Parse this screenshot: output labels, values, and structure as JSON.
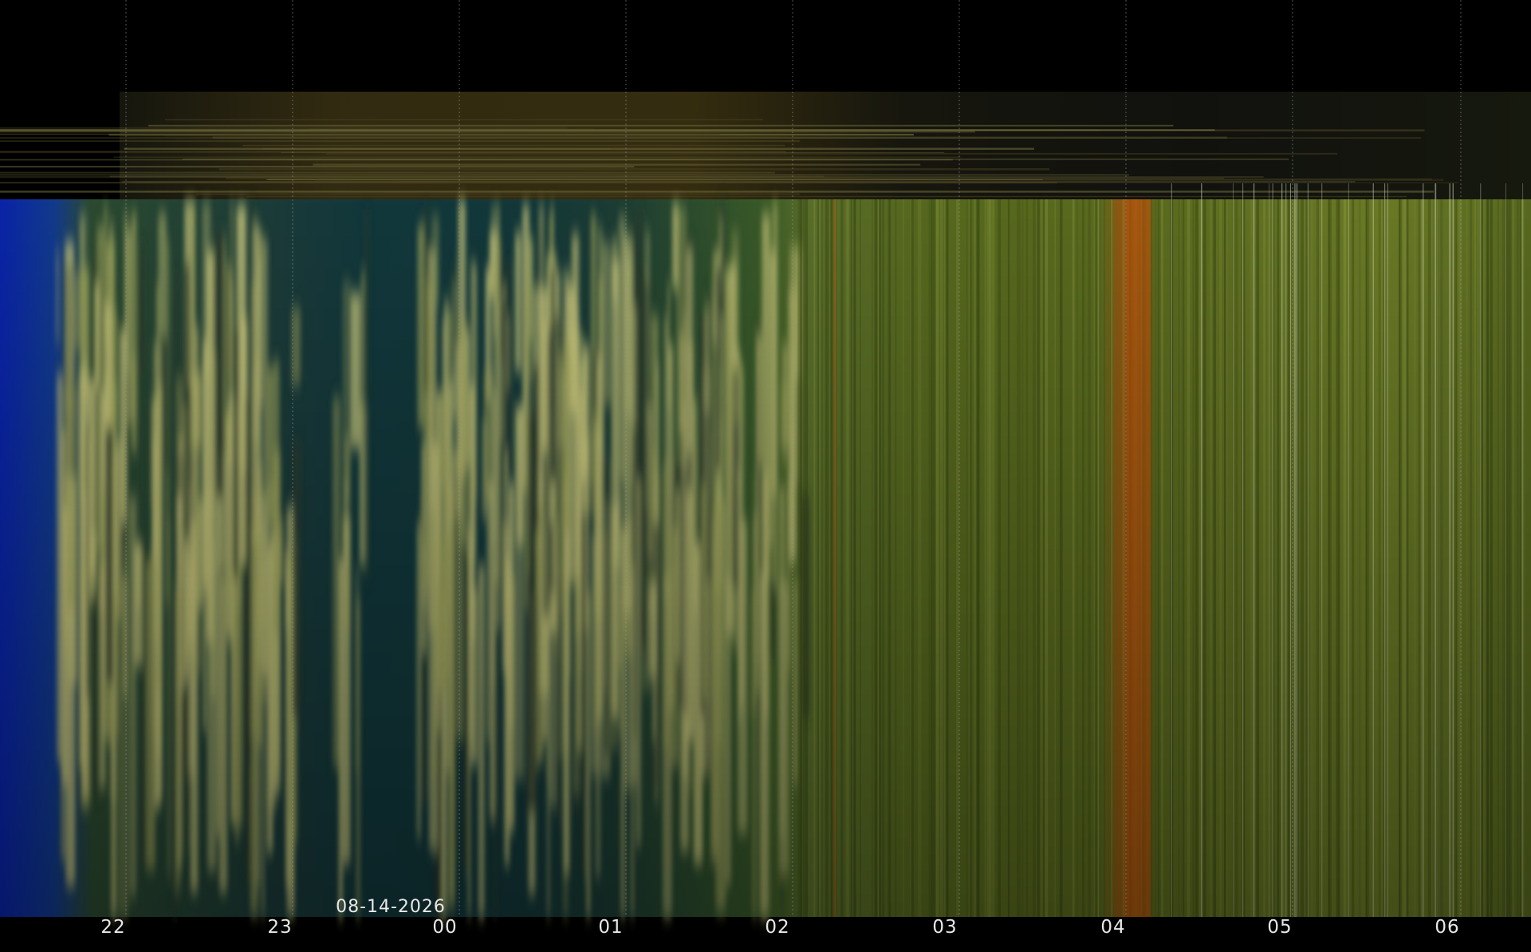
{
  "date_label": "08-14-2026",
  "hour_ticks": [
    "22",
    "23",
    "00",
    "01",
    "02",
    "03",
    "04",
    "05",
    "06"
  ],
  "palette": {
    "background": "#000000",
    "band": "#3a2e10",
    "dusk_blue": "#0a2a9a",
    "teal": "#0e3a3e",
    "cloud_yellow": "#c8c878",
    "olive": "#5a6a1e",
    "orange_streak": "#b85a10",
    "gridline": "#9a9a9a",
    "label": "#e8e8e8"
  }
}
